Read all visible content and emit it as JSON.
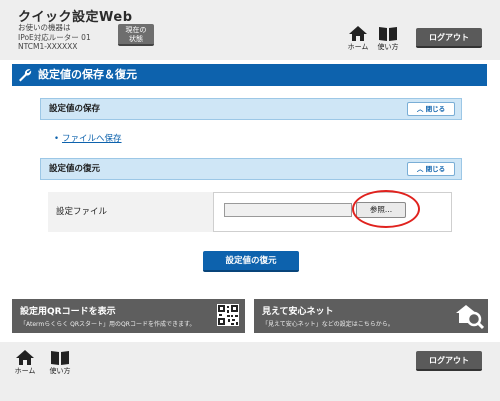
{
  "header": {
    "title": "クイック設定Web",
    "device_lines": [
      "お使いの機器は",
      "IPoE対応ルーター 01",
      "NTCM1-XXXXXX"
    ],
    "status_button": [
      "現在の",
      "状態"
    ],
    "nav": {
      "home": "ホーム",
      "manual": "使い方"
    },
    "logout": "ログアウト"
  },
  "page": {
    "title": "設定値の保存＆復元"
  },
  "save_section": {
    "title": "設定値の保存",
    "close_label": "閉じる",
    "link": "ファイルへ保存"
  },
  "restore_section": {
    "title": "設定値の復元",
    "close_label": "閉じる",
    "file_label": "設定ファイル",
    "file_value": "",
    "browse_label": "参照...",
    "restore_button": "設定値の復元"
  },
  "panels": {
    "qr": {
      "title": "設定用QRコードを表示",
      "desc": "「Atermらくらく QRスタート」用のQRコードを作成できます。"
    },
    "safe": {
      "title": "見えて安心ネット",
      "desc": "「見えて安心ネット」などの設定はこちらから。"
    }
  },
  "footer": {
    "nav": {
      "home": "ホーム",
      "manual": "使い方"
    },
    "logout": "ログアウト"
  },
  "colors": {
    "accent": "#0d62ad",
    "section_bg": "#cfe6f6",
    "highlight": "#e0221e",
    "panel_bg": "#5e5e5e"
  }
}
